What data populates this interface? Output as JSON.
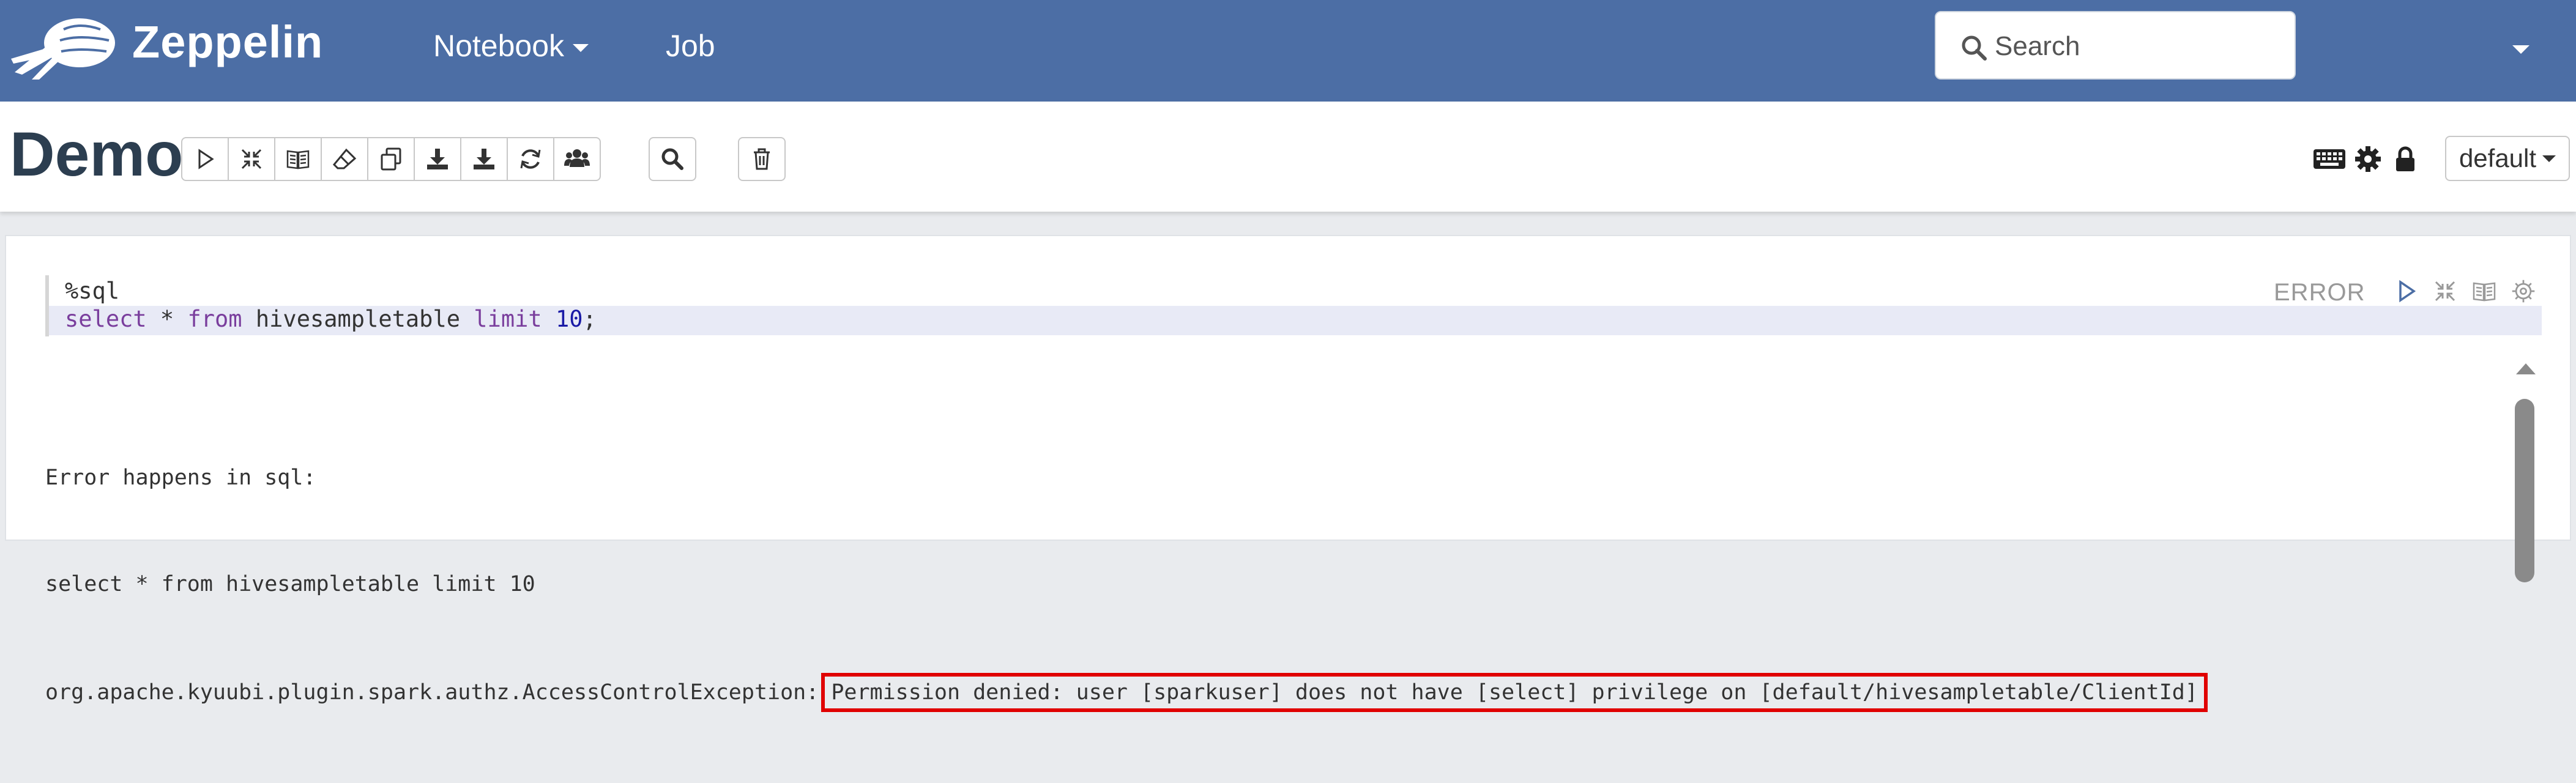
{
  "navbar": {
    "brand": "Zeppelin",
    "menu": [
      {
        "label": "Notebook",
        "has_dropdown": true
      },
      {
        "label": "Job",
        "has_dropdown": false
      }
    ],
    "search_placeholder": "Search",
    "user_menu_icon": "chevron-down-icon",
    "background_color": "#4c6ea5"
  },
  "header": {
    "title": "Demo",
    "toolbar_buttons": [
      {
        "name": "run-all-button",
        "icon": "play-icon"
      },
      {
        "name": "hide-code-button",
        "icon": "compress-icon"
      },
      {
        "name": "hide-output-button",
        "icon": "book-icon"
      },
      {
        "name": "clear-output-button",
        "icon": "eraser-icon"
      },
      {
        "name": "clone-button",
        "icon": "copy-icon"
      },
      {
        "name": "export-button",
        "icon": "download-icon"
      },
      {
        "name": "export-ipynb-button",
        "icon": "download-icon"
      },
      {
        "name": "version-control-button",
        "icon": "refresh-icon"
      },
      {
        "name": "permissions-button",
        "icon": "users-icon"
      }
    ],
    "search_button_icon": "search-icon",
    "trash_button_icon": "trash-icon",
    "right_icons": [
      "keyboard-icon",
      "gear-icon",
      "lock-icon"
    ],
    "interpreter_selector": "default"
  },
  "paragraph": {
    "code_line1": "%sql",
    "code_line2_tokens": [
      {
        "text": "select",
        "type": "kw"
      },
      {
        "text": " * ",
        "type": "plain"
      },
      {
        "text": "from",
        "type": "kw"
      },
      {
        "text": " hivesampletable ",
        "type": "plain"
      },
      {
        "text": "limit",
        "type": "kw"
      },
      {
        "text": " ",
        "type": "plain"
      },
      {
        "text": "10",
        "type": "num"
      },
      {
        "text": ";",
        "type": "plain"
      }
    ],
    "status": "ERROR",
    "controls": [
      "play-icon",
      "compress-icon",
      "book-icon",
      "gear-icon"
    ],
    "output": {
      "line1": "Error happens in sql:",
      "line2": "select * from hivesampletable limit 10",
      "line3_prefix": "org.apache.kyuubi.plugin.spark.authz.AccessControlException:",
      "line3_highlight": "Permission denied: user [sparkuser] does not have [select] privilege on [default/hivesampletable/ClientId]"
    },
    "highlight_color": "#e00000"
  }
}
